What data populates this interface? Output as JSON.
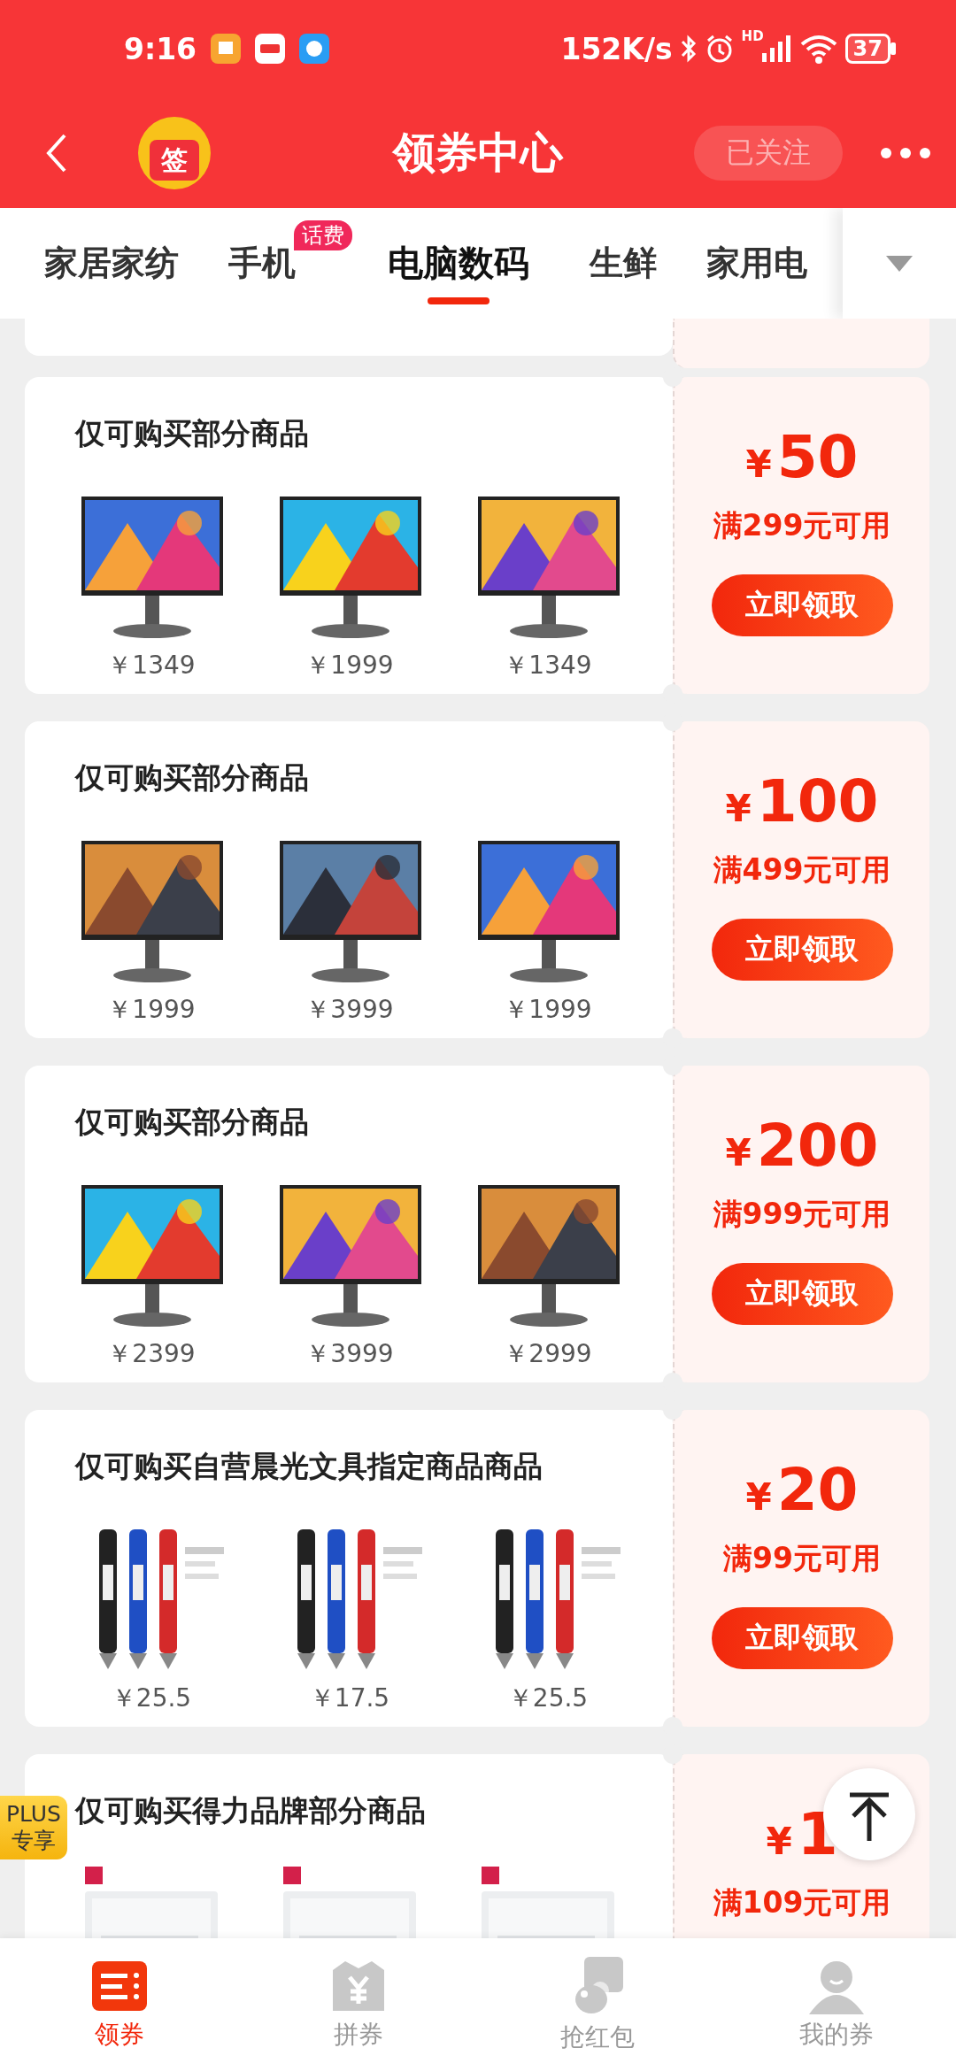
{
  "status_bar": {
    "time": "9:16",
    "speed": "152K/s",
    "network_label": "HD",
    "battery": "37"
  },
  "header": {
    "logo_text": "签",
    "title": "领券中心",
    "follow_button": {
      "label": "已关注",
      "followed": true
    }
  },
  "tabs": [
    {
      "label": "家居家纺",
      "selected": false
    },
    {
      "label": "手机",
      "badge": "话费",
      "selected": false
    },
    {
      "label": "电脑数码",
      "selected": true
    },
    {
      "label": "生鲜",
      "selected": false
    },
    {
      "label": "家用电",
      "selected": false
    }
  ],
  "coupons": [
    {
      "title": "仅可购买部分商品",
      "products": [
        {
          "kind": "picture",
          "price": "￥1349"
        },
        {
          "kind": "picture",
          "price": "￥1999"
        },
        {
          "kind": "picture",
          "price": "￥1349"
        }
      ],
      "currency": "¥",
      "amount": "50",
      "condition": "满299元可用",
      "button": "立即领取"
    },
    {
      "title": "仅可购买部分商品",
      "products": [
        {
          "kind": "picture",
          "price": "￥1999"
        },
        {
          "kind": "picture",
          "price": "￥3999"
        },
        {
          "kind": "picture",
          "price": "￥1999"
        }
      ],
      "currency": "¥",
      "amount": "100",
      "condition": "满499元可用",
      "button": "立即领取"
    },
    {
      "title": "仅可购买部分商品",
      "products": [
        {
          "kind": "picture",
          "price": "￥2399"
        },
        {
          "kind": "picture",
          "price": "￥3999"
        },
        {
          "kind": "picture",
          "price": "￥2999"
        }
      ],
      "currency": "¥",
      "amount": "200",
      "condition": "满999元可用",
      "button": "立即领取"
    },
    {
      "title": "仅可购买自营晨光文具指定商品商品",
      "products": [
        {
          "kind": "picture",
          "price": "￥25.5"
        },
        {
          "kind": "picture",
          "price": "￥17.5"
        },
        {
          "kind": "picture",
          "price": "￥25.5"
        }
      ],
      "currency": "¥",
      "amount": "20",
      "condition": "满99元可用",
      "button": "立即领取"
    },
    {
      "title": "仅可购买得力品牌部分商品",
      "badge": "PLUS 专享",
      "currency": "¥",
      "amount": "1",
      "condition": "满109元可用"
    }
  ],
  "bottom_nav": [
    {
      "label": "领券",
      "selected": true
    },
    {
      "label": "拼券",
      "selected": false
    },
    {
      "label": "抢红包",
      "selected": false
    },
    {
      "label": "我的券",
      "selected": false
    }
  ]
}
